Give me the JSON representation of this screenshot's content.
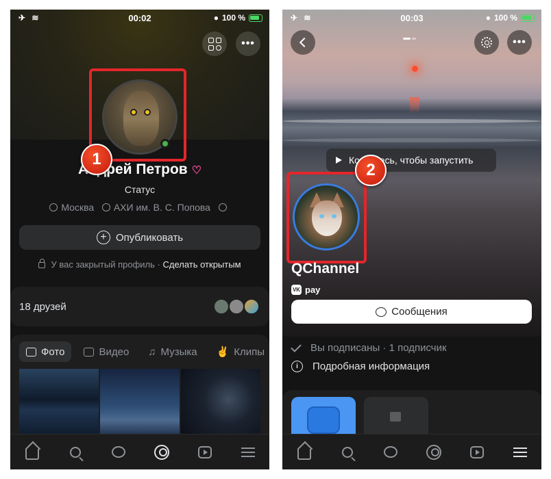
{
  "left": {
    "status": {
      "time": "00:02",
      "battery": "100 %"
    },
    "profile": {
      "badge_number": "1",
      "name": "Андрей Петров",
      "status_text": "Статус",
      "city": "Москва",
      "university": "АХИ им. В. С. Попова"
    },
    "publish_label": "Опубликовать",
    "private_notice": "У вас закрытый профиль",
    "make_open_link": "Сделать открытым",
    "friends_label": "18 друзей",
    "media_tabs": [
      "Фото",
      "Видео",
      "Музыка",
      "Клипы"
    ]
  },
  "right": {
    "status": {
      "time": "00:03",
      "battery": "100 %"
    },
    "cover_prompt": "Коснитесь, чтобы запустить",
    "badge_number": "2",
    "channel_name": "QChannel",
    "pay_label": "pay",
    "messages_label": "Сообщения",
    "subscribed_info": "Вы подписаны · 1 подписчик",
    "details_label": "Подробная информация"
  },
  "colors": {
    "highlight": "#e3262b",
    "badge": "#d42a16",
    "online": "#4bb34b",
    "accent_blue": "#3a7be0",
    "background": "#141414"
  },
  "icons": {
    "tabbar": [
      "home-icon",
      "search-icon",
      "messages-icon",
      "profile-icon",
      "video-icon",
      "menu-icon"
    ]
  }
}
